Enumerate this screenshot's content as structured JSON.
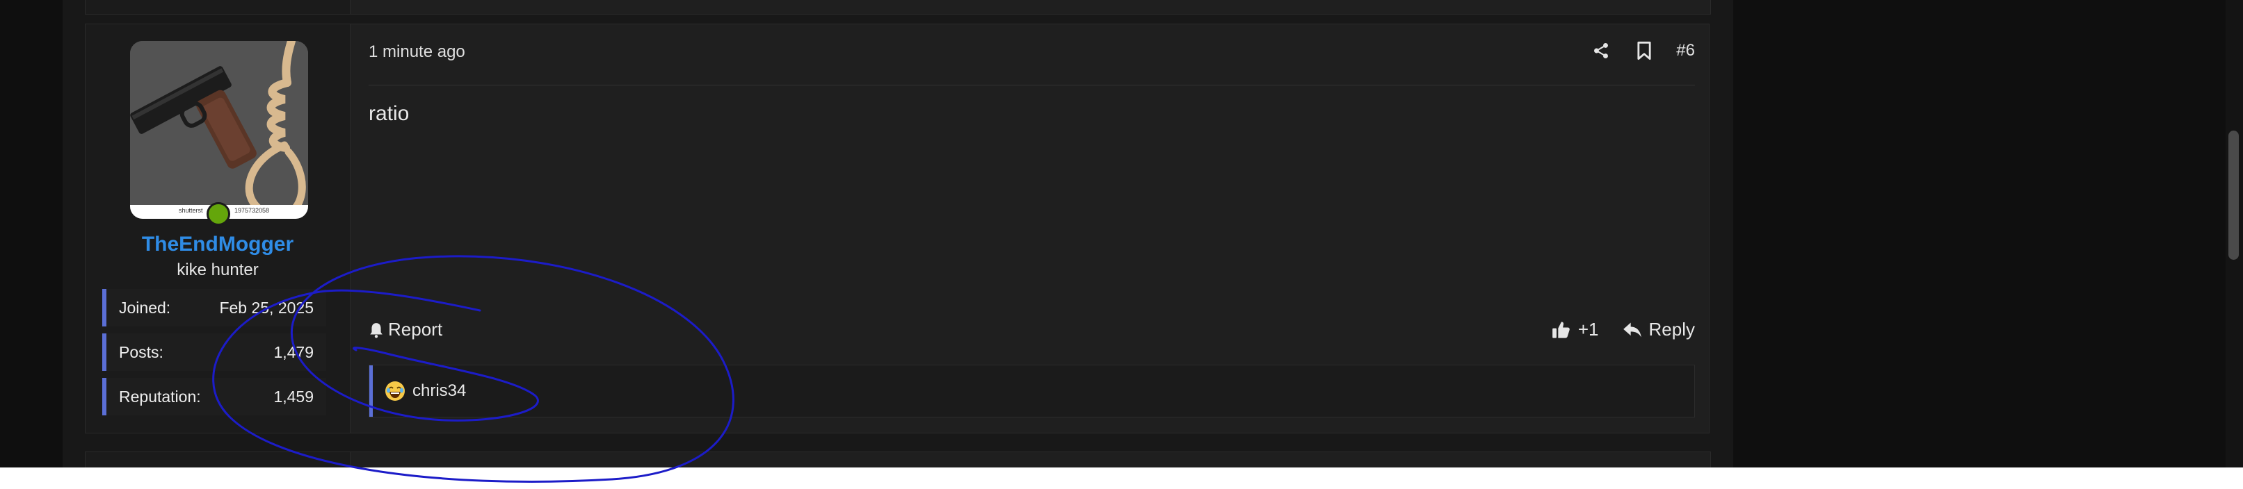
{
  "post": {
    "timestamp": "1 minute ago",
    "post_number": "#6",
    "message": "ratio",
    "author": {
      "username": "TheEndMogger",
      "user_title": "kike hunter",
      "avatar_watermark_left": "shutterst",
      "avatar_watermark_right": "1975732058",
      "stats": [
        {
          "label": "Joined:",
          "value": "Feb 25, 2025"
        },
        {
          "label": "Posts:",
          "value": "1,479"
        },
        {
          "label": "Reputation:",
          "value": "1,459"
        }
      ]
    },
    "actions": {
      "report_label": "Report",
      "like_count": "+1",
      "reply_label": "Reply"
    },
    "reactions": {
      "users": "chris34"
    }
  },
  "icons": [
    "share-icon",
    "bookmark-icon",
    "bell-icon",
    "thumbs-up-icon",
    "reply-icon",
    "laughing-emoji-icon"
  ],
  "colors": {
    "username": "#2f8ce6",
    "accent_bar": "#5b6fd6",
    "online": "#64a60b",
    "annotation_ink": "#1c1cc8"
  }
}
